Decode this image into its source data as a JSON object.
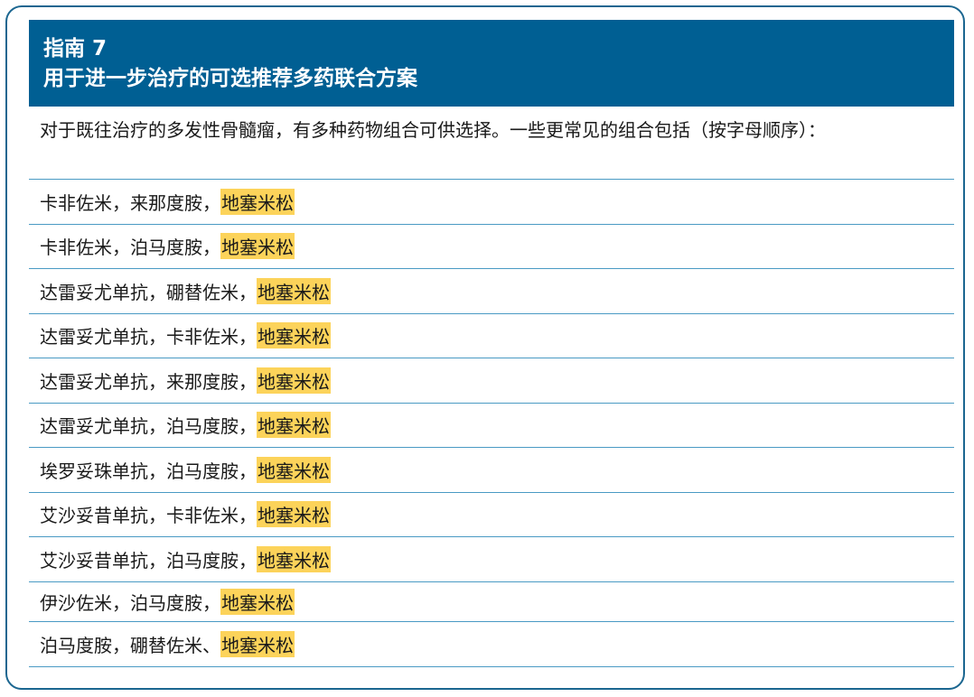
{
  "header": {
    "line1": "指南 7",
    "line2": "用于进一步治疗的可选推荐多药联合方案"
  },
  "intro": "对于既往治疗的多发性骨髓瘤，有多种药物组合可供选择。一些更常见的组合包括（按字母顺序）：",
  "regimens": [
    {
      "text": "卡非佐米，来那度胺，",
      "highlight": "地塞米松"
    },
    {
      "text": "卡非佐米，泊马度胺，",
      "highlight": "地塞米松"
    },
    {
      "text": "达雷妥尤单抗，硼替佐米，",
      "highlight": "地塞米松"
    },
    {
      "text": "达雷妥尤单抗，卡非佐米，",
      "highlight": "地塞米松"
    },
    {
      "text": "达雷妥尤单抗，来那度胺，",
      "highlight": "地塞米松"
    },
    {
      "text": "达雷妥尤单抗，泊马度胺，",
      "highlight": "地塞米松"
    },
    {
      "text": "埃罗妥珠单抗，泊马度胺，",
      "highlight": "地塞米松"
    },
    {
      "text": "艾沙妥昔单抗，卡非佐米，",
      "highlight": "地塞米松"
    },
    {
      "text": "艾沙妥昔单抗，泊马度胺，",
      "highlight": "地塞米松"
    },
    {
      "text": "伊沙佐米，泊马度胺，",
      "highlight": "地塞米松"
    },
    {
      "text": "泊马度胺，硼替佐米、",
      "highlight": "地塞米松"
    }
  ],
  "colors": {
    "header_bg": "#005f93",
    "border": "#1b6690",
    "rule": "#4a9ac4",
    "highlight": "#fcd35a"
  }
}
